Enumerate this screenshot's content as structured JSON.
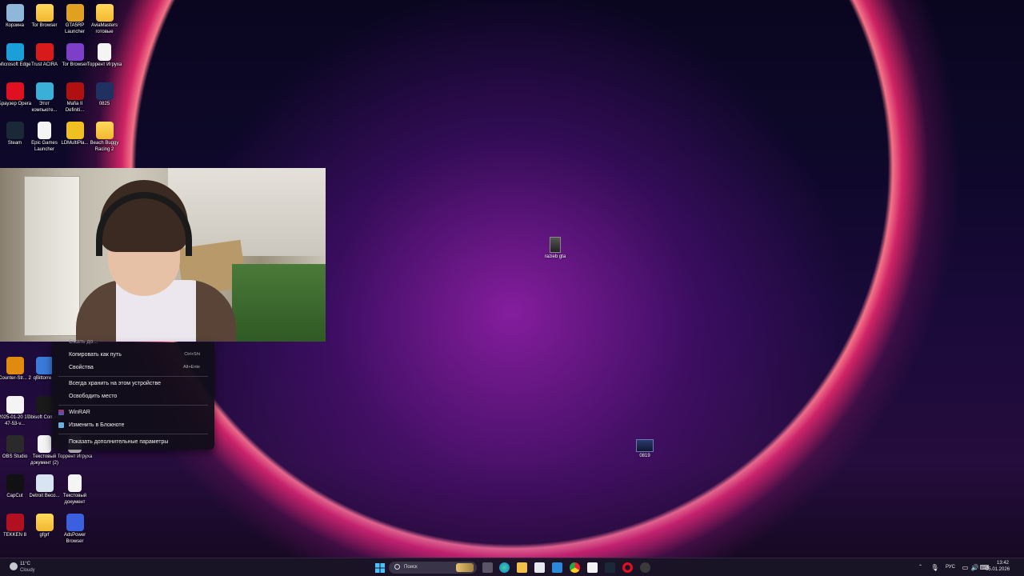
{
  "desktop": {
    "icons_left": [
      {
        "label": "Корзина",
        "icon": "recycle-bin-icon",
        "color": "#8fb8d8"
      },
      {
        "label": "Tor Browser",
        "icon": "folder-icon",
        "color": "#f2c14a"
      },
      {
        "label": "GTA5RP Launcher",
        "icon": "gta5rp-icon",
        "color": "#e0a020"
      },
      {
        "label": "AviaMasters готовые",
        "icon": "folder-icon",
        "color": "#f2c14a"
      },
      {
        "label": "Microsoft Edge",
        "icon": "edge-icon",
        "color": "#1a9fd8"
      },
      {
        "label": "Trust ACIRA",
        "icon": "trust-acira-icon",
        "color": "#d81a1a"
      },
      {
        "label": "Tor Browser",
        "icon": "tor-browser-icon",
        "color": "#7d3ec8"
      },
      {
        "label": "Торрент Игруха",
        "icon": "document-icon",
        "color": "#f4f4f4"
      },
      {
        "label": "Браузер Opera",
        "icon": "opera-icon",
        "color": "#e01020"
      },
      {
        "label": "Этот компьюте...",
        "icon": "computer-icon",
        "color": "#3ab0d8"
      },
      {
        "label": "Mafia II Definiti...",
        "icon": "mafia-icon",
        "color": "#b01010"
      },
      {
        "label": "0825",
        "icon": "video-file-icon",
        "color": "#203060"
      },
      {
        "label": "Steam",
        "icon": "steam-icon",
        "color": "#1b2838"
      },
      {
        "label": "Epic Games Launcher",
        "icon": "document-icon",
        "color": "#f4f4f4"
      },
      {
        "label": "LDMultiPla...",
        "icon": "ldplayer-icon",
        "color": "#f0c020"
      },
      {
        "label": "Beach Buggy Racing 2",
        "icon": "folder-icon",
        "color": "#f2c14a"
      }
    ],
    "icons_lower": [
      {
        "label": "Counter-Str... 2",
        "icon": "counter-strike-icon",
        "color": "#e08a10"
      },
      {
        "label": "qBittorre...",
        "icon": "qbittorrent-icon",
        "color": "#3a7ad8"
      },
      {
        "label": "2025-01-20 17-47-53-v...",
        "icon": "video-file-icon",
        "color": "#f4f4f4"
      },
      {
        "label": "Ubisoft Connect",
        "icon": "ubisoft-icon",
        "color": "#1a1a1a"
      },
      {
        "label": "OBS Studio",
        "icon": "obs-icon",
        "color": "#2a2a2a"
      },
      {
        "label": "Текстовый документ (2)",
        "icon": "document-icon",
        "color": "#f4f4f4"
      },
      {
        "label": "Торрент Игруха",
        "icon": "document-icon",
        "color": "#f4f4f4"
      },
      {
        "label": "CapCut",
        "icon": "capcut-icon",
        "color": "#111111"
      },
      {
        "label": "Detroit Beco...",
        "icon": "detroit-icon",
        "color": "#d8e4f0"
      },
      {
        "label": "Текстовый документ",
        "icon": "document-icon",
        "color": "#f4f4f4"
      },
      {
        "label": "TEKKEN 8",
        "icon": "tekken-icon",
        "color": "#b01020"
      },
      {
        "label": "gfgrf",
        "icon": "folder-icon",
        "color": "#f2c14a"
      },
      {
        "label": "AdsPower Browser",
        "icon": "adspower-icon",
        "color": "#3a60e0"
      }
    ],
    "icon_razieb": {
      "label": "razieb gta",
      "icon": "image-file-icon"
    },
    "icon_0819": {
      "label": "0819",
      "icon": "video-file-icon"
    }
  },
  "context_menu": {
    "partial_top": "Сжать до...",
    "items": [
      {
        "label": "Копировать как путь",
        "shortcut": "Ctrl+Shi"
      },
      {
        "label": "Свойства",
        "shortcut": "Alt+Ente"
      },
      {
        "label": "Всегда хранить на этом устройстве",
        "shortcut": ""
      },
      {
        "label": "Освободить место",
        "shortcut": ""
      },
      {
        "label": "WinRAR",
        "shortcut": "",
        "icon": "winrar-icon"
      },
      {
        "label": "Изменить в Блокноте",
        "shortcut": "",
        "icon": "notepad-icon"
      },
      {
        "label": "Показать дополнительные параметры",
        "shortcut": ""
      }
    ]
  },
  "taskbar": {
    "weather_temp": "11°C",
    "weather_desc": "Cloudy",
    "search_placeholder": "Поиск",
    "language": "РУС",
    "time": "13:42",
    "date": "05.01.2026"
  }
}
